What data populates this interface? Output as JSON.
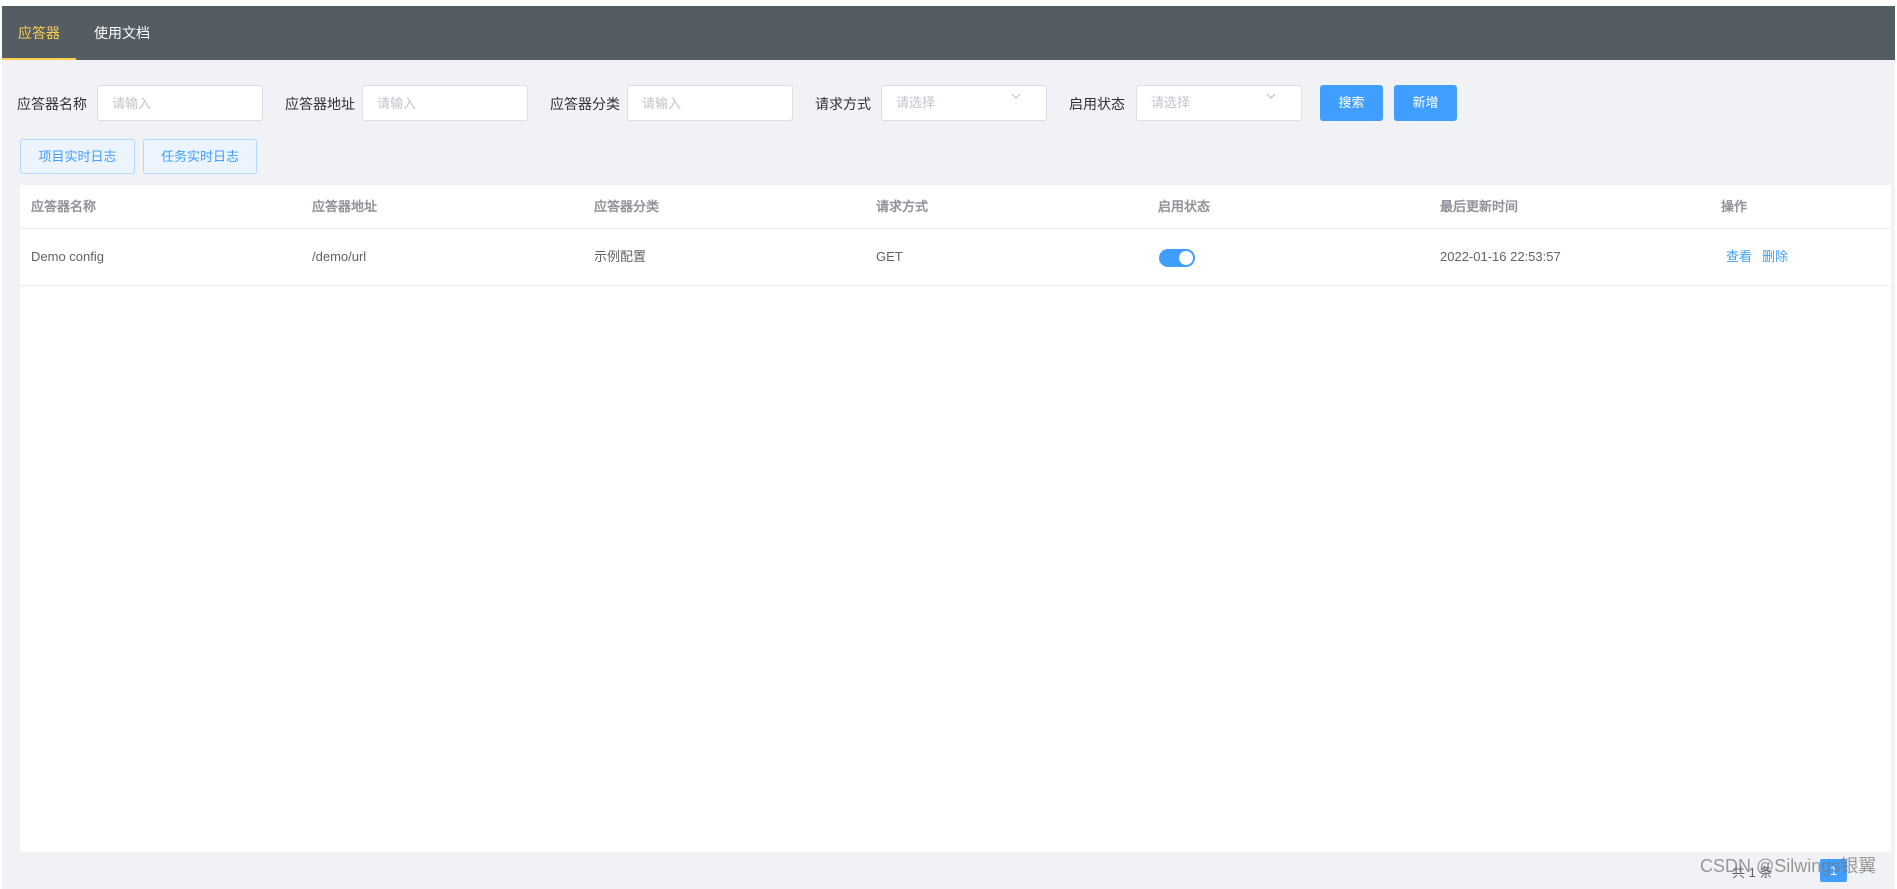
{
  "nav": {
    "tabs": [
      {
        "label": "应答器",
        "active": true
      },
      {
        "label": "使用文档",
        "active": false
      }
    ],
    "background": "#545c64",
    "active_color": "#ffd04b"
  },
  "filters": {
    "name": {
      "label": "应答器名称",
      "placeholder": "请输入"
    },
    "address": {
      "label": "应答器地址",
      "placeholder": "请输入"
    },
    "category": {
      "label": "应答器分类",
      "placeholder": "请输入"
    },
    "method": {
      "label": "请求方式",
      "placeholder": "请选择"
    },
    "status": {
      "label": "启用状态",
      "placeholder": "请选择"
    },
    "search_button": "搜索",
    "add_button": "新增"
  },
  "log_buttons": {
    "project_log": "项目实时日志",
    "task_log": "任务实时日志"
  },
  "table": {
    "columns": [
      "应答器名称",
      "应答器地址",
      "应答器分类",
      "请求方式",
      "启用状态",
      "最后更新时间",
      "操作"
    ],
    "rows": [
      {
        "name": "Demo config",
        "address": "/demo/url",
        "category": "示例配置",
        "method": "GET",
        "enabled": true,
        "updated_at": "2022-01-16 22:53:57",
        "actions": [
          "查看",
          "删除"
        ]
      }
    ]
  },
  "pagination": {
    "total_text": "共 1 条",
    "current_page": "1"
  },
  "watermark": "CSDN @Silwings银翼",
  "accent_color": "#409eff"
}
